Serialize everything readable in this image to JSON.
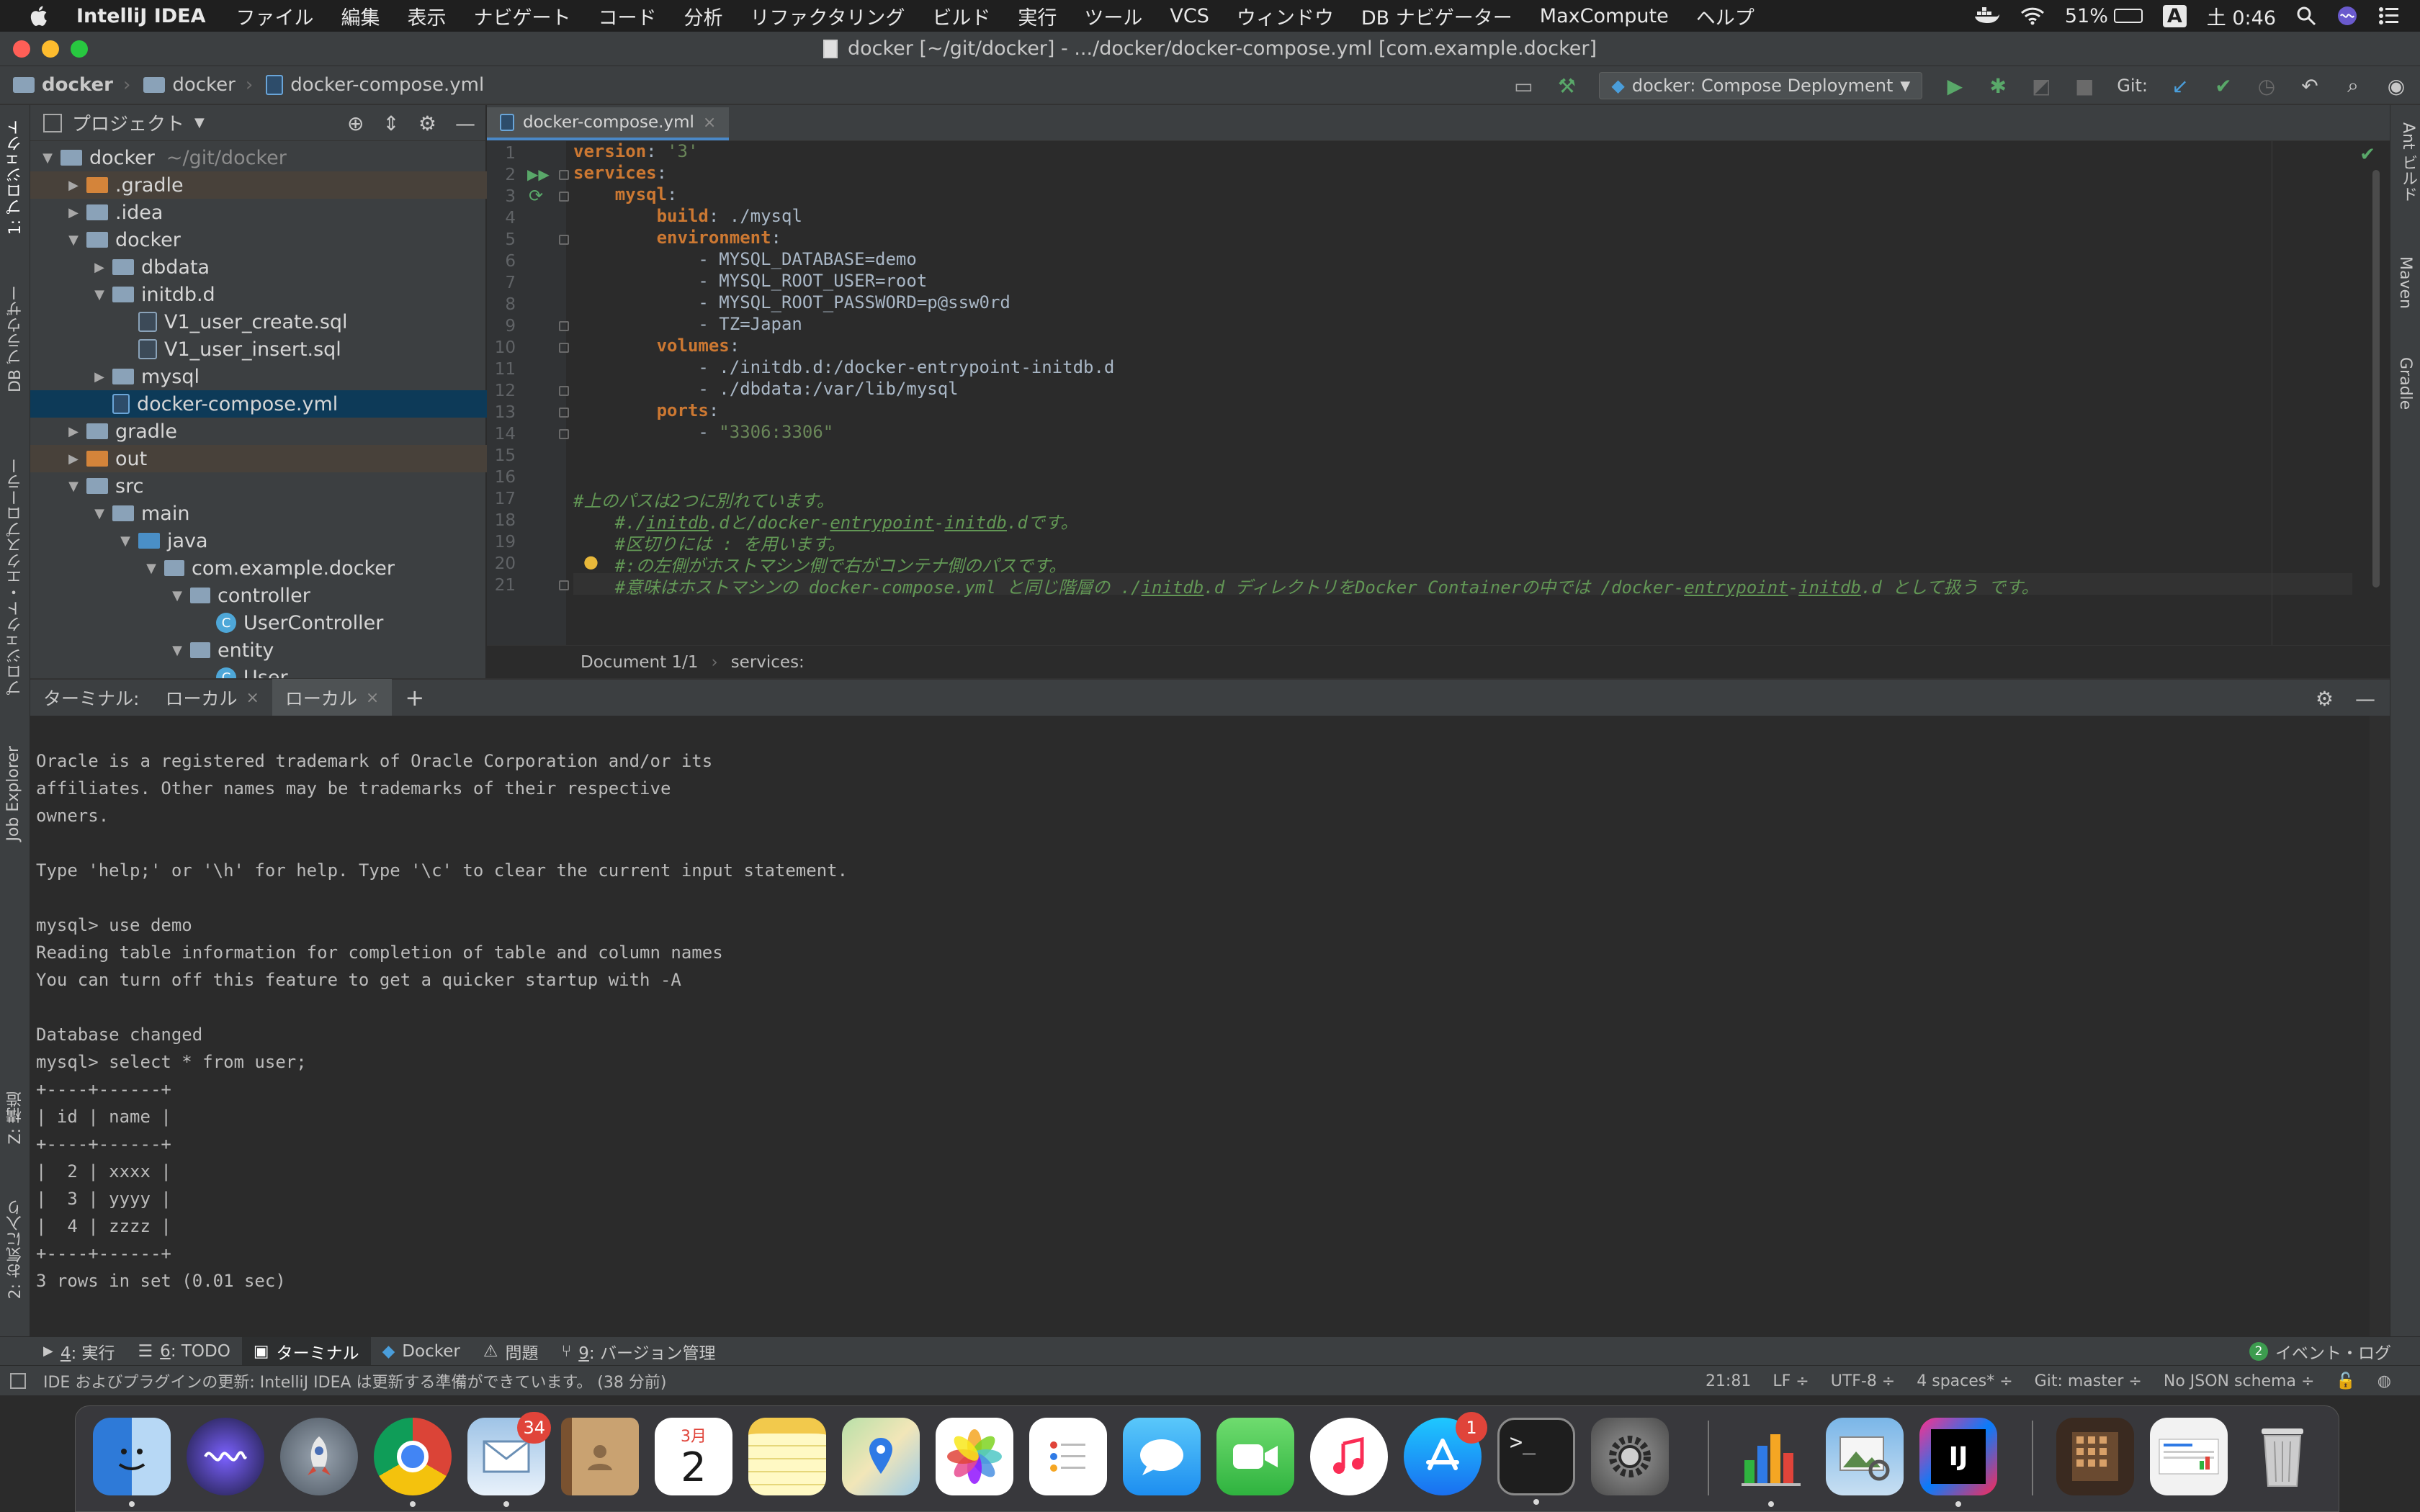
{
  "menubar": {
    "app_name": "IntelliJ IDEA",
    "items": [
      "ファイル",
      "編集",
      "表示",
      "ナビゲート",
      "コード",
      "分析",
      "リファクタリング",
      "ビルド",
      "実行",
      "ツール",
      "VCS",
      "ウィンドウ",
      "DB ナビゲーター",
      "MaxCompute",
      "ヘルプ"
    ],
    "battery": "51%",
    "input_source": "A",
    "clock": "土 0:46",
    "battery_level": 0.51
  },
  "window": {
    "title": "docker [~/git/docker] - .../docker/docker-compose.yml [com.example.docker]"
  },
  "navbar": {
    "crumbs": [
      "docker",
      "docker",
      "docker-compose.yml"
    ],
    "run_config": "docker: Compose Deployment",
    "git_label": "Git:"
  },
  "left_tabs": {
    "project": "1: プロジェクト",
    "db_browser": "DB ブラウザー",
    "project_explorer": "プロジェクト・エクスプローラー",
    "job_explorer": "Job Explorer",
    "structure": "Z: 構造",
    "favorites": "2: お気に入り"
  },
  "right_tabs": {
    "ant": "Ant ビルド",
    "maven": "Maven",
    "gradle": "Gradle"
  },
  "project": {
    "header": "プロジェクト",
    "tree": [
      {
        "label": "docker",
        "hint": "~/git/docker",
        "depth": 0,
        "arrow": "▼",
        "type": "folder"
      },
      {
        "label": ".gradle",
        "depth": 1,
        "arrow": "▶",
        "type": "orange"
      },
      {
        "label": ".idea",
        "depth": 1,
        "arrow": "▶",
        "type": "folder"
      },
      {
        "label": "docker",
        "depth": 1,
        "arrow": "▼",
        "type": "folder"
      },
      {
        "label": "dbdata",
        "depth": 2,
        "arrow": "▶",
        "type": "folder"
      },
      {
        "label": "initdb.d",
        "depth": 2,
        "arrow": "▼",
        "type": "folder"
      },
      {
        "label": "V1_user_create.sql",
        "depth": 3,
        "arrow": "",
        "type": "sql"
      },
      {
        "label": "V1_user_insert.sql",
        "depth": 3,
        "arrow": "",
        "type": "sql"
      },
      {
        "label": "mysql",
        "depth": 2,
        "arrow": "▶",
        "type": "folder"
      },
      {
        "label": "docker-compose.yml",
        "depth": 2,
        "arrow": "",
        "type": "yml"
      },
      {
        "label": "gradle",
        "depth": 1,
        "arrow": "▶",
        "type": "folder"
      },
      {
        "label": "out",
        "depth": 1,
        "arrow": "▶",
        "type": "orange"
      },
      {
        "label": "src",
        "depth": 1,
        "arrow": "▼",
        "type": "folder"
      },
      {
        "label": "main",
        "depth": 2,
        "arrow": "▼",
        "type": "folder"
      },
      {
        "label": "java",
        "depth": 3,
        "arrow": "▼",
        "type": "blue"
      },
      {
        "label": "com.example.docker",
        "depth": 4,
        "arrow": "▼",
        "type": "pkg"
      },
      {
        "label": "controller",
        "depth": 5,
        "arrow": "▼",
        "type": "pkg"
      },
      {
        "label": "UserController",
        "depth": 6,
        "arrow": "",
        "type": "java"
      },
      {
        "label": "entity",
        "depth": 5,
        "arrow": "▼",
        "type": "pkg"
      },
      {
        "label": "User",
        "depth": 6,
        "arrow": "",
        "type": "java"
      }
    ]
  },
  "editor": {
    "tab": "docker-compose.yml",
    "line_numbers": [
      "1",
      "2",
      "3",
      "4",
      "5",
      "6",
      "7",
      "8",
      "9",
      "10",
      "11",
      "12",
      "13",
      "14",
      "15",
      "16",
      "17",
      "18",
      "19",
      "20",
      "21"
    ],
    "lines": {
      "l1_key": "version",
      "l1_val": "'3'",
      "l2_key": "services",
      "l3_key": "mysql",
      "l4_key": "build",
      "l4_val": "./mysql",
      "l5_key": "environment",
      "l6": "- MYSQL_DATABASE=demo",
      "l7": "- MYSQL_ROOT_USER=root",
      "l8": "- MYSQL_ROOT_PASSWORD=p@ssw0rd",
      "l9": "- TZ=Japan",
      "l10_key": "volumes",
      "l11": "- ./initdb.d:/docker-entrypoint-initdb.d",
      "l12": "- ./dbdata:/var/lib/mysql",
      "l13_key": "ports",
      "l14_dash": "- ",
      "l14_val": "\"3306:3306\"",
      "l17": "#上のパスは2つに別れています。",
      "l18_a": "#./",
      "l18_b": "initdb",
      "l18_c": ".dと/docker-",
      "l18_d": "entrypoint",
      "l18_e": "-",
      "l18_f": "initdb",
      "l18_g": ".dです。",
      "l19": "#区切りには : を用います。",
      "l20": "#:の左側がホストマシン側で右がコンテナ側のパスです。",
      "l21_a": "#意味はホストマシンの docker-compose.yml と同じ階層の ./",
      "l21_b": "initdb",
      "l21_c": ".d ディレクトリをDocker Containerの中では /docker-",
      "l21_d": "entrypoint",
      "l21_e": "-",
      "l21_f": "initdb",
      "l21_g": ".d として扱う です。"
    },
    "breadcrumb_doc": "Document 1/1",
    "breadcrumb_node": "services:"
  },
  "terminal": {
    "label": "ターミナル:",
    "tabs": [
      "ローカル",
      "ローカル"
    ],
    "lines": [
      "Oracle is a registered trademark of Oracle Corporation and/or its",
      "affiliates. Other names may be trademarks of their respective",
      "owners.",
      "",
      "Type 'help;' or '\\h' for help. Type '\\c' to clear the current input statement.",
      "",
      "mysql> use demo",
      "Reading table information for completion of table and column names",
      "You can turn off this feature to get a quicker startup with -A",
      "",
      "Database changed",
      "mysql> select * from user;",
      "+----+------+",
      "| id | name |",
      "+----+------+",
      "|  2 | xxxx |",
      "|  3 | yyyy |",
      "|  4 | zzzz |",
      "+----+------+",
      "3 rows in set (0.01 sec)"
    ]
  },
  "bottom_tools": {
    "run_num": "4",
    "run": ": 実行",
    "todo_num": "6",
    "todo": ": TODO",
    "terminal": "ターミナル",
    "docker": "Docker",
    "problems": "問題",
    "vcs_num": "9",
    "vcs": ": バージョン管理",
    "event_count": "2",
    "event_log": "イベント・ログ"
  },
  "statusbar": {
    "message": "IDE およびプラグインの更新: IntelliJ IDEA は更新する準備ができています。 (38 分前)",
    "position": "21:81",
    "line_sep": "LF ÷",
    "encoding": "UTF-8 ÷",
    "indent": "4 spaces* ÷",
    "git": "Git: master ÷",
    "schema": "No JSON schema ÷"
  },
  "dock": {
    "mail_badge": "34",
    "calendar_month": "3月",
    "calendar_day": "2",
    "appstore_badge": "1",
    "terminal_glyph": ">_",
    "intellij_glyph": "IJ"
  }
}
